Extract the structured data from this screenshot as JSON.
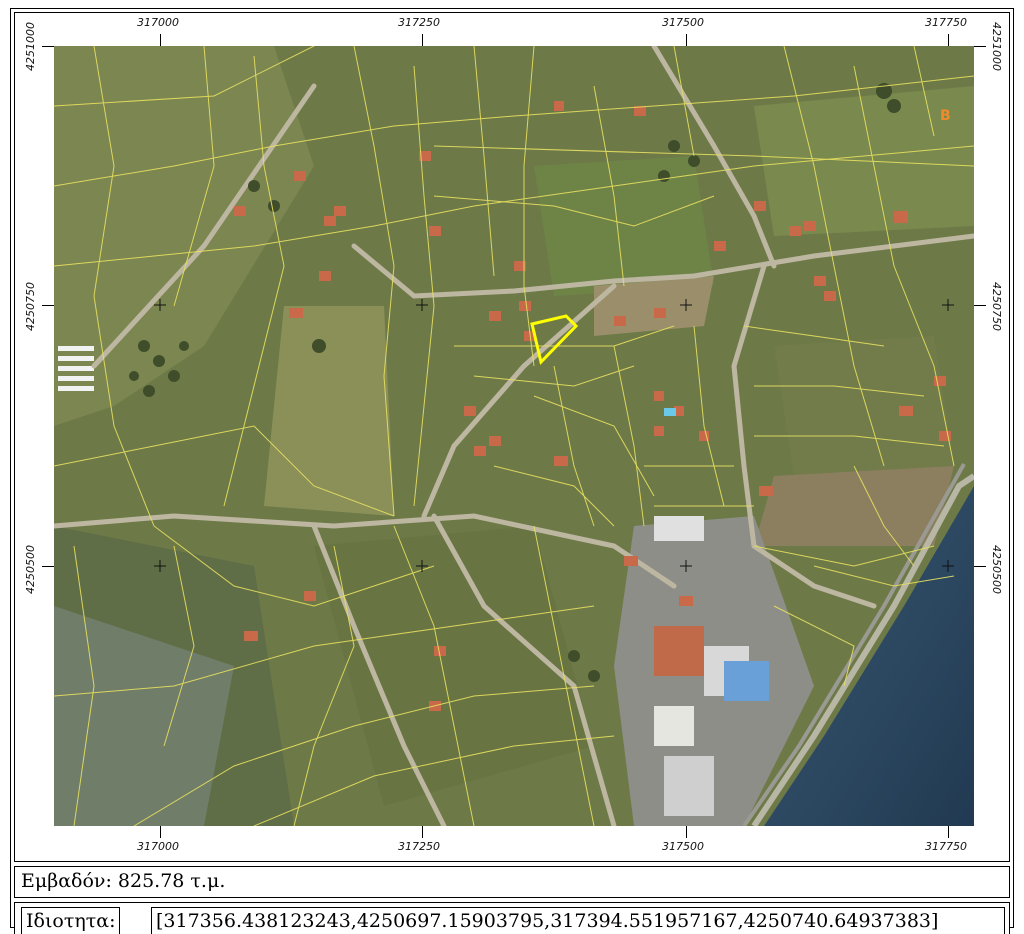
{
  "map": {
    "x_ticks": [
      "317000",
      "317250",
      "317500",
      "317750"
    ],
    "y_ticks": [
      "4251000",
      "4250750",
      "4250500"
    ],
    "zone_label": "B",
    "colors": {
      "parcel_lines": "#e8e060",
      "selected_parcel": "#ffff00",
      "sea": "#2d4a63",
      "field": "#6f7a4c",
      "zone_label": "#f08a2a"
    }
  },
  "area": {
    "text": "Εμβαδόν: 825.78 τ.μ."
  },
  "property": {
    "label": "Ιδιοτητα:",
    "value": "[317356.438123243,4250697.15903795,317394.551957167,4250740.64937383]"
  }
}
